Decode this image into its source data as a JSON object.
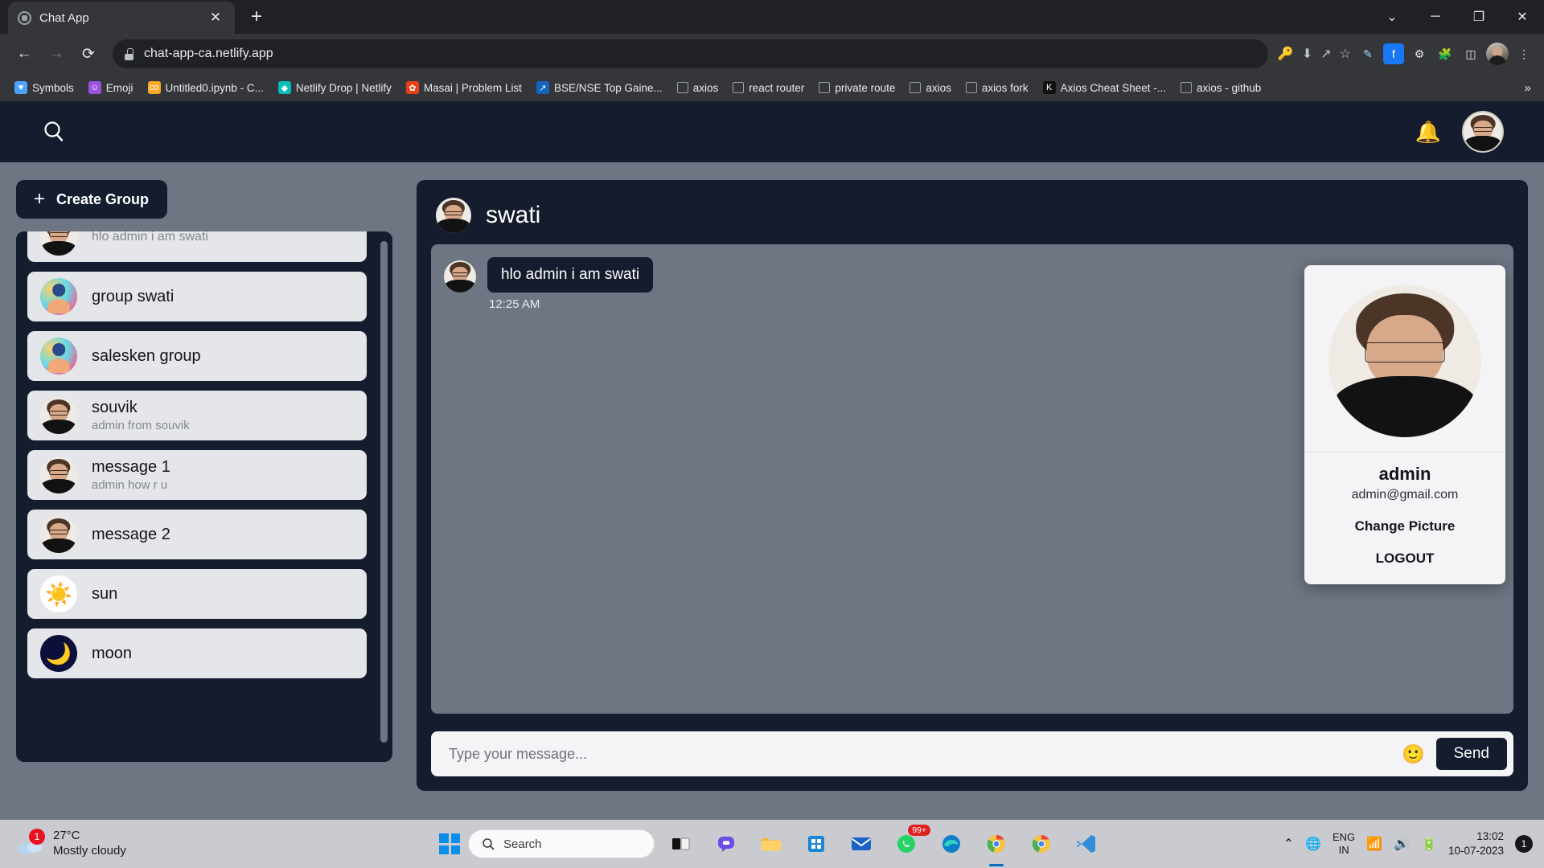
{
  "browser": {
    "tab": {
      "title": "Chat App",
      "favicon": "chat-app-favicon",
      "close_label": "✕"
    },
    "new_tab_label": "+",
    "window_controls": {
      "minimize_group": "⌄",
      "minimize": "─",
      "maximize": "❐",
      "close": "✕"
    },
    "nav": {
      "back": "←",
      "forward": "→",
      "reload": "⟳"
    },
    "omnibox": {
      "url": "chat-app-ca.netlify.app",
      "lock": "lock-icon"
    },
    "omni_actions": [
      "key-icon",
      "download-icon",
      "share-icon",
      "star-icon"
    ],
    "toolbar_icons": [
      "pen-icon",
      "facebook-icon",
      "gear-icon",
      "puzzle-icon",
      "sidepanel-icon"
    ],
    "bookmarks": [
      {
        "label": "Symbols",
        "icon": "heart-icon",
        "color": "#4aa3ff",
        "glyph": "♥"
      },
      {
        "label": "Emoji",
        "icon": "emoji-icon",
        "color": "#9b51e0",
        "glyph": "☺"
      },
      {
        "label": "Untitled0.ipynb - C...",
        "icon": "colab-icon",
        "color": "#f9a825",
        "glyph": "co"
      },
      {
        "label": "Netlify Drop | Netlify",
        "icon": "netlify-icon",
        "color": "#05bdba",
        "glyph": "◆"
      },
      {
        "label": "Masai | Problem List",
        "icon": "masai-icon",
        "color": "#e84118",
        "glyph": "✿"
      },
      {
        "label": "BSE/NSE Top Gaine...",
        "icon": "chart-icon",
        "color": "#1565c0",
        "glyph": "↗"
      },
      {
        "label": "axios",
        "icon": "blank-page-icon",
        "color": "",
        "glyph": ""
      },
      {
        "label": "react router",
        "icon": "blank-page-icon",
        "color": "",
        "glyph": ""
      },
      {
        "label": "private route",
        "icon": "blank-page-icon",
        "color": "",
        "glyph": ""
      },
      {
        "label": "axios",
        "icon": "blank-page-icon",
        "color": "",
        "glyph": ""
      },
      {
        "label": "axios fork",
        "icon": "blank-page-icon",
        "color": "",
        "glyph": ""
      },
      {
        "label": "Axios Cheat Sheet -...",
        "icon": "kindacode-icon",
        "color": "#111111",
        "glyph": "K"
      },
      {
        "label": "axios - github",
        "icon": "blank-page-icon",
        "color": "",
        "glyph": ""
      }
    ],
    "bookmarks_overflow": "»"
  },
  "app": {
    "header": {
      "search_icon": "search-icon",
      "bell_icon": "bell-icon",
      "avatar": "user-avatar"
    },
    "sidebar": {
      "create_group_label": "Create Group",
      "create_group_plus": "+",
      "chats": [
        {
          "name": "",
          "sub": "hlo admin i am swati",
          "avatar": "photo"
        },
        {
          "name": "group swati",
          "sub": "",
          "avatar": "group"
        },
        {
          "name": "salesken group",
          "sub": "",
          "avatar": "group"
        },
        {
          "name": "souvik",
          "sub": "admin from souvik",
          "avatar": "photo"
        },
        {
          "name": "message 1",
          "sub": "admin how r u",
          "avatar": "photo"
        },
        {
          "name": "message 2",
          "sub": "",
          "avatar": "photo"
        },
        {
          "name": "sun",
          "sub": "",
          "avatar": "sun"
        },
        {
          "name": "moon",
          "sub": "",
          "avatar": "moon"
        }
      ]
    },
    "chat": {
      "title": "swati",
      "messages": [
        {
          "text": "hlo admin i am swati",
          "time": "12:25 AM",
          "avatar": "photo"
        }
      ],
      "input_placeholder": "Type your message...",
      "input_value": "",
      "emoji_icon": "emoji-icon",
      "send_label": "Send"
    },
    "profile_menu": {
      "name": "admin",
      "email": "admin@gmail.com",
      "change_picture_label": "Change Picture",
      "logout_label": "LOGOUT"
    },
    "colors": {
      "panel_dark": "#141c2e",
      "page_bg": "#6e7583",
      "chat_item_bg": "#e4e6e9"
    }
  },
  "taskbar": {
    "weather": {
      "temp": "27°C",
      "desc": "Mostly cloudy",
      "badge": "1"
    },
    "search_placeholder": "Search",
    "search_icon": "search-icon",
    "start_icon": "windows-start-icon",
    "apps": [
      {
        "name": "task-view-icon"
      },
      {
        "name": "teams-icon"
      },
      {
        "name": "file-explorer-icon"
      },
      {
        "name": "microsoft-store-icon"
      },
      {
        "name": "mail-icon"
      },
      {
        "name": "whatsapp-icon",
        "badge": "99+"
      },
      {
        "name": "edge-icon"
      },
      {
        "name": "chrome-icon"
      },
      {
        "name": "chrome-icon"
      },
      {
        "name": "vscode-icon"
      }
    ],
    "tray": {
      "chevron": "⌃",
      "network_icon": "network-icon",
      "wifi_icon": "wifi-icon",
      "volume_icon": "volume-icon",
      "battery_icon": "battery-icon"
    },
    "language": {
      "line1": "ENG",
      "line2": "IN"
    },
    "clock": {
      "time": "13:02",
      "date": "10-07-2023"
    },
    "notification_count": "1"
  }
}
